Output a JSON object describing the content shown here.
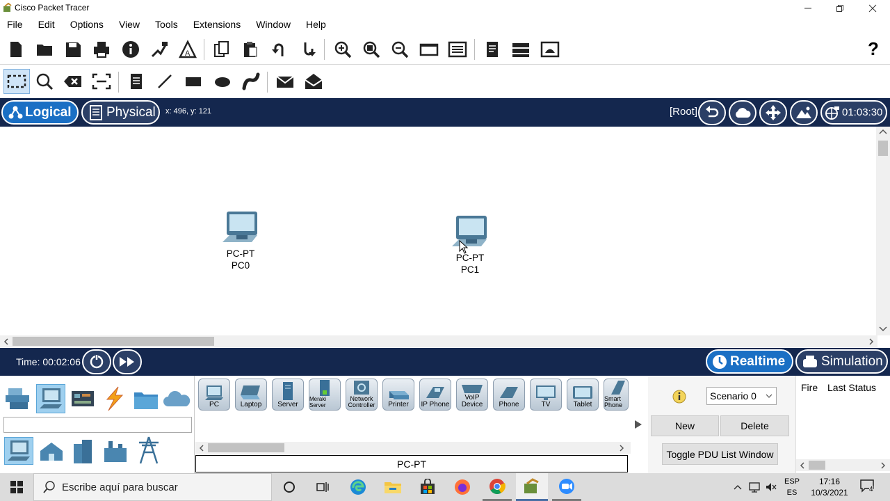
{
  "window": {
    "title": "Cisco Packet Tracer"
  },
  "menu": [
    "File",
    "Edit",
    "Options",
    "View",
    "Tools",
    "Extensions",
    "Window",
    "Help"
  ],
  "main_toolbar": {
    "icons": [
      "new-file-icon",
      "open-folder-icon",
      "save-icon",
      "print-icon",
      "info-icon",
      "network-wizard-icon",
      "activity-wizard-icon",
      "copy-icon",
      "paste-icon",
      "undo-icon",
      "redo-icon",
      "zoom-in-icon",
      "zoom-reset-icon",
      "zoom-out-icon",
      "drawing-palette-icon",
      "custom-device-dialog-icon",
      "text-file-icon",
      "cluster-icon",
      "physical-view-icon"
    ],
    "help": "?"
  },
  "edit_toolbar": {
    "icons": [
      "select-icon",
      "inspect-icon",
      "delete-icon",
      "resize-icon",
      "note-icon",
      "line-icon",
      "rectangle-icon",
      "ellipse-icon",
      "freeform-icon",
      "simple-pdu-icon",
      "complex-pdu-icon"
    ]
  },
  "mode_bar": {
    "logical_label": "Logical",
    "physical_label": "Physical",
    "coords": "x: 496, y: 121",
    "root_label": "[Root]",
    "clock": "01:03:30"
  },
  "workspace": {
    "devices": [
      {
        "model": "PC-PT",
        "name": "PC0"
      },
      {
        "model": "PC-PT",
        "name": "PC1"
      }
    ]
  },
  "sim_bar": {
    "time_label": "Time: 00:02:06",
    "realtime_label": "Realtime",
    "simulation_label": "Simulation"
  },
  "device_palette": {
    "search_value": "",
    "device_types": [
      "PC",
      "Laptop",
      "Server",
      "Meraki Server",
      "Network Controller",
      "Printer",
      "IP Phone",
      "VoIP Device",
      "Phone",
      "TV",
      "Tablet",
      "Smart Phone"
    ],
    "selected_device_label": "PC-PT"
  },
  "pdu_panel": {
    "scenario_value": "Scenario 0",
    "new_label": "New",
    "delete_label": "Delete",
    "toggle_label": "Toggle PDU List Window",
    "col_fire": "Fire",
    "col_last_status": "Last Status"
  },
  "taskbar": {
    "search_placeholder": "Escribe aquí para buscar",
    "lang1": "ESP",
    "lang2": "ES",
    "time": "17:16",
    "date": "10/3/2021",
    "notification_count": "4"
  },
  "colors": {
    "mode_bar_bg": "#14274e",
    "pill_active": "#1a6fc4",
    "workspace_bg": "#ffffff"
  }
}
